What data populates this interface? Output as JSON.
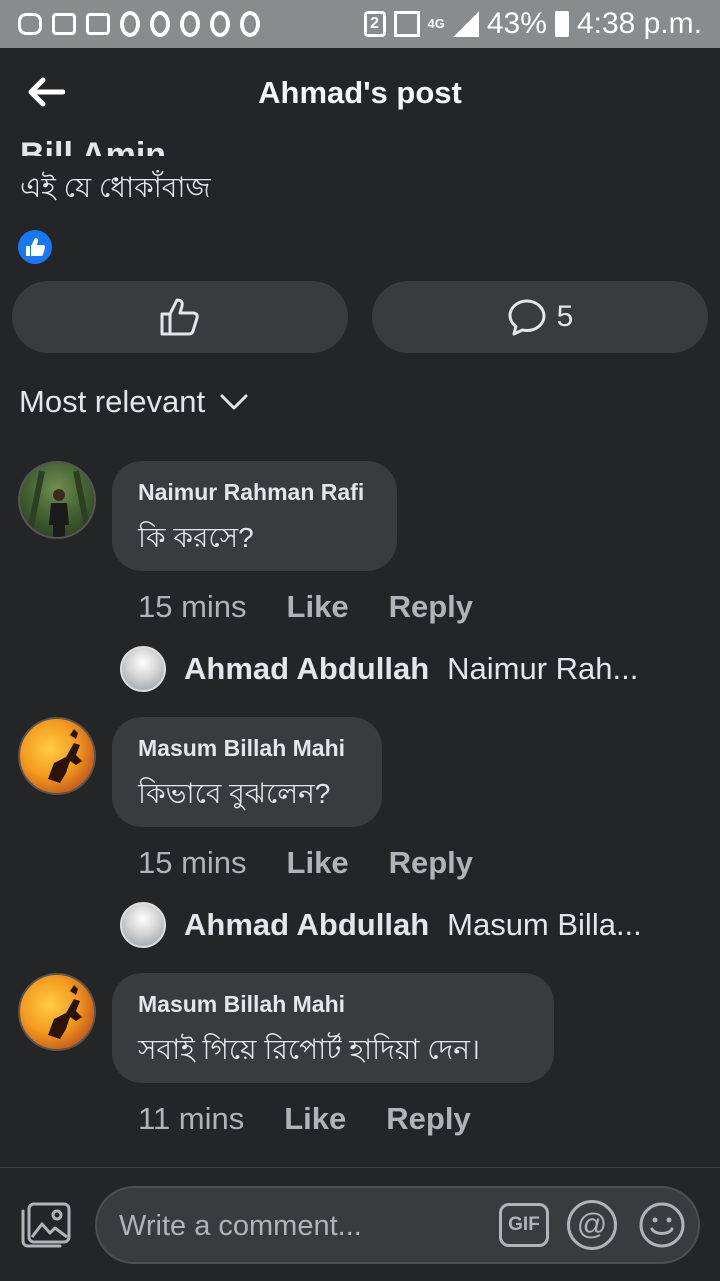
{
  "status_bar": {
    "sim_slot": "2",
    "network": "4G",
    "battery": "43%",
    "time": "4:38 p.m."
  },
  "header": {
    "title": "Ahmad's post"
  },
  "post": {
    "author_cut": "Bill Amin",
    "text": "এই যে ধোকাঁবাজ",
    "comment_count": "5"
  },
  "sort": {
    "label": "Most relevant"
  },
  "comments": [
    {
      "author": "Naimur Rahman Rafi",
      "text": "কি করসে?",
      "time": "15 mins",
      "like": "Like",
      "reply": "Reply",
      "reply_preview": {
        "author": "Ahmad Abdullah",
        "text": "Naimur Rah..."
      }
    },
    {
      "author": "Masum Billah Mahi",
      "text": "কিভাবে বুঝলেন?",
      "time": "15 mins",
      "like": "Like",
      "reply": "Reply",
      "reply_preview": {
        "author": "Ahmad Abdullah",
        "text": "Masum Billa..."
      }
    },
    {
      "author": "Masum Billah Mahi",
      "text": "সবাই গিয়ে রিপোর্ট হাদিয়া দেন।",
      "time": "11 mins",
      "like": "Like",
      "reply": "Reply"
    }
  ],
  "composer": {
    "placeholder": "Write a comment...",
    "gif_label": "GIF",
    "at_label": "@"
  }
}
